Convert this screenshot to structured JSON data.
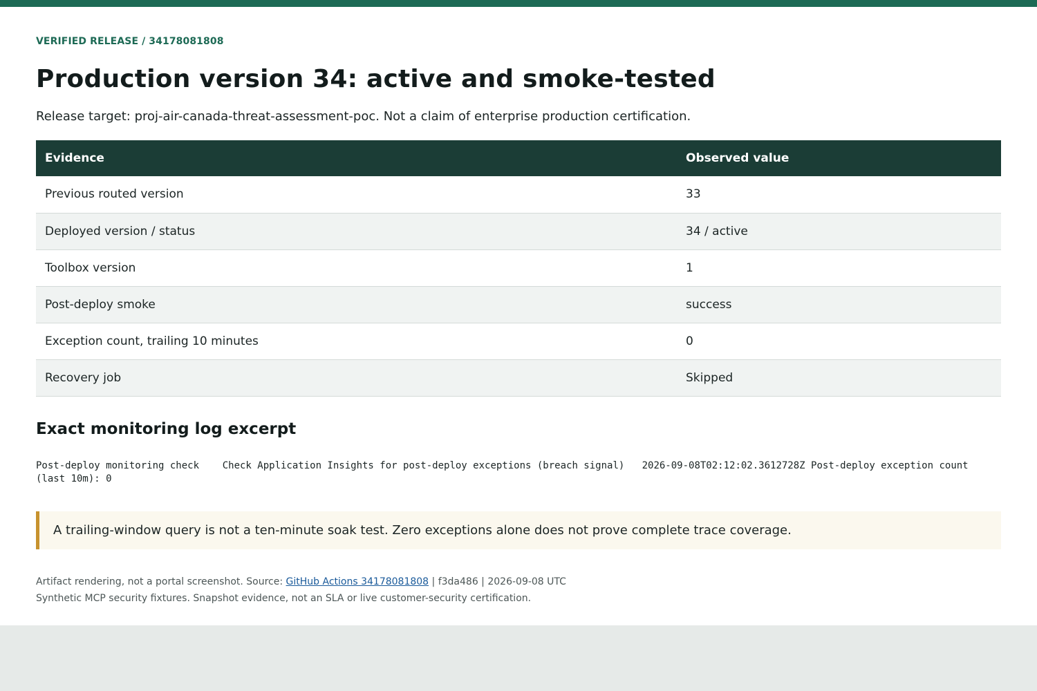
{
  "header": {
    "eyebrow": "VERIFIED RELEASE / 34178081808",
    "title": "Production version 34: active and smoke-tested",
    "subtitle": "Release target: proj-air-canada-threat-assessment-poc. Not a claim of enterprise production certification."
  },
  "table": {
    "columns": [
      "Evidence",
      "Observed value"
    ],
    "rows": [
      [
        "Previous routed version",
        "33"
      ],
      [
        "Deployed version / status",
        "34 / active"
      ],
      [
        "Toolbox version",
        "1"
      ],
      [
        "Post-deploy smoke",
        "success"
      ],
      [
        "Exception count, trailing 10 minutes",
        "0"
      ],
      [
        "Recovery job",
        "Skipped"
      ]
    ]
  },
  "log_section": {
    "title": "Exact monitoring log excerpt",
    "excerpt": "Post-deploy monitoring check\tCheck Application Insights for post-deploy exceptions (breach signal)\t2026-09-08T02:12:02.3612728Z Post-deploy exception count (last 10m): 0"
  },
  "callout": {
    "text": "A trailing-window query is not a ten-minute soak test. Zero exceptions alone does not prove complete trace coverage."
  },
  "footer": {
    "source_prefix": "Artifact rendering, not a portal screenshot. Source: ",
    "source_link": "GitHub Actions 34178081808",
    "source_suffix": " | f3da486 | 2026-09-08 UTC",
    "disclaimer": "Synthetic MCP security fixtures. Snapshot evidence, not an SLA or live customer-security certification."
  },
  "colors": {
    "accent": "#1d6a55",
    "table_header": "#1b3d36",
    "callout_border": "#c7922e",
    "link": "#1a5a9a"
  }
}
